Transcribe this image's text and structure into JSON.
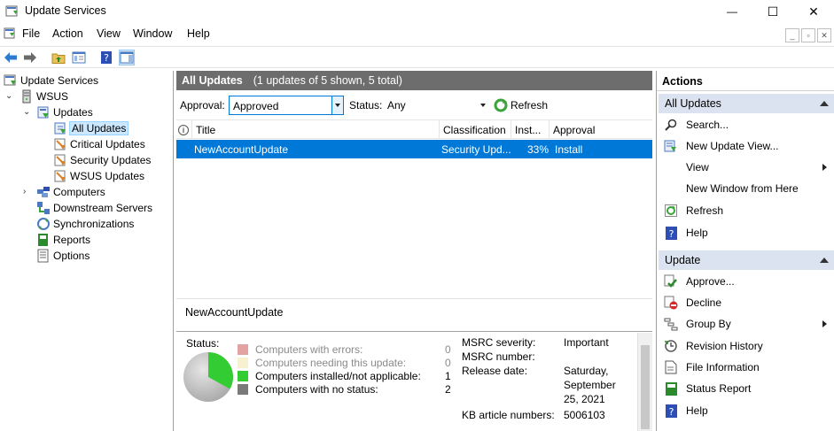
{
  "window": {
    "title": "Update Services",
    "minimize": "—",
    "maximize": "☐",
    "close": "✕"
  },
  "menu": [
    "File",
    "Action",
    "View",
    "Window",
    "Help"
  ],
  "tree": {
    "root": "Update Services",
    "server": "WSUS",
    "updates": "Updates",
    "all_updates": "All Updates",
    "critical": "Critical Updates",
    "security": "Security Updates",
    "wsus_updates": "WSUS Updates",
    "computers": "Computers",
    "downstream": "Downstream Servers",
    "sync": "Synchronizations",
    "reports": "Reports",
    "options": "Options"
  },
  "center": {
    "header_title": "All Updates",
    "header_count": "(1 updates of 5 shown, 5 total)",
    "approval_label": "Approval:",
    "approval_value": "Approved",
    "status_label": "Status:",
    "status_value": "Any",
    "refresh_label": "Refresh",
    "columns": {
      "info": "i",
      "title": "Title",
      "classification": "Classification",
      "installed": "Inst...",
      "approval": "Approval"
    },
    "rows": [
      {
        "title": "NewAccountUpdate",
        "classification": "Security Upd...",
        "installed": "33%",
        "approval": "Install"
      }
    ],
    "detail_title": "NewAccountUpdate",
    "detail": {
      "status_label": "Status:",
      "legend": [
        {
          "label": "Computers with errors:",
          "count": "0",
          "color": "#e3a3a3",
          "disabled": true
        },
        {
          "label": "Computers needing this update:",
          "count": "0",
          "color": "#f7f1cf",
          "disabled": true
        },
        {
          "label": "Computers installed/not applicable:",
          "count": "1",
          "color": "#33cc33",
          "disabled": false
        },
        {
          "label": "Computers with no status:",
          "count": "2",
          "color": "#7a7a7a",
          "disabled": false
        }
      ],
      "pie_installed_fraction": 0.33,
      "msrc_severity_label": "MSRC severity:",
      "msrc_severity": "Important",
      "msrc_number_label": "MSRC number:",
      "msrc_number": "",
      "release_date_label": "Release date:",
      "release_date_line1": "Saturday,",
      "release_date_line2": "September",
      "release_date_line3": "25, 2021",
      "kb_label": "KB article numbers:",
      "kb": "5006103"
    }
  },
  "actions": {
    "header": "Actions",
    "section1": "All Updates",
    "items1": [
      "Search...",
      "New Update View...",
      "View",
      "New Window from Here",
      "Refresh",
      "Help"
    ],
    "section2": "Update",
    "items2": [
      "Approve...",
      "Decline",
      "Group By",
      "Revision History",
      "File Information",
      "Status Report",
      "Help"
    ]
  },
  "colors": {
    "selection": "#0078d7",
    "section_bg": "#dae3ef",
    "header_bg": "#6d6d6d"
  }
}
